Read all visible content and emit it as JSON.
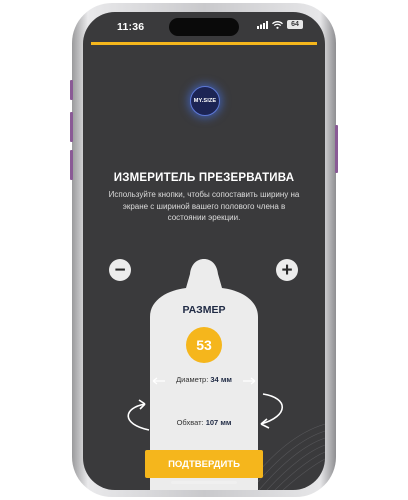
{
  "status_bar": {
    "time": "11:36",
    "battery": "64"
  },
  "logo": {
    "text": "MY.SIZE"
  },
  "title": "ИЗМЕРИТЕЛЬ ПРЕЗЕРВАТИВА",
  "description": "Используйте кнопки, чтобы сопоставить ширину на экране с шириной вашего полового члена в состоянии эрекции.",
  "controls": {
    "minus": "−",
    "plus": "+"
  },
  "gauge": {
    "size_label": "РАЗМЕР",
    "size_value": "53",
    "diameter_label": "Диаметр:",
    "diameter_value": "34 мм",
    "girth_label": "Обхват:",
    "girth_value": "107 мм"
  },
  "confirm_button": "ПОДТВЕРДИТЬ",
  "colors": {
    "accent": "#f5b61c",
    "screen_bg": "#3a3a3c",
    "gauge_fill": "#ececec",
    "text_dark": "#1f2a44"
  }
}
